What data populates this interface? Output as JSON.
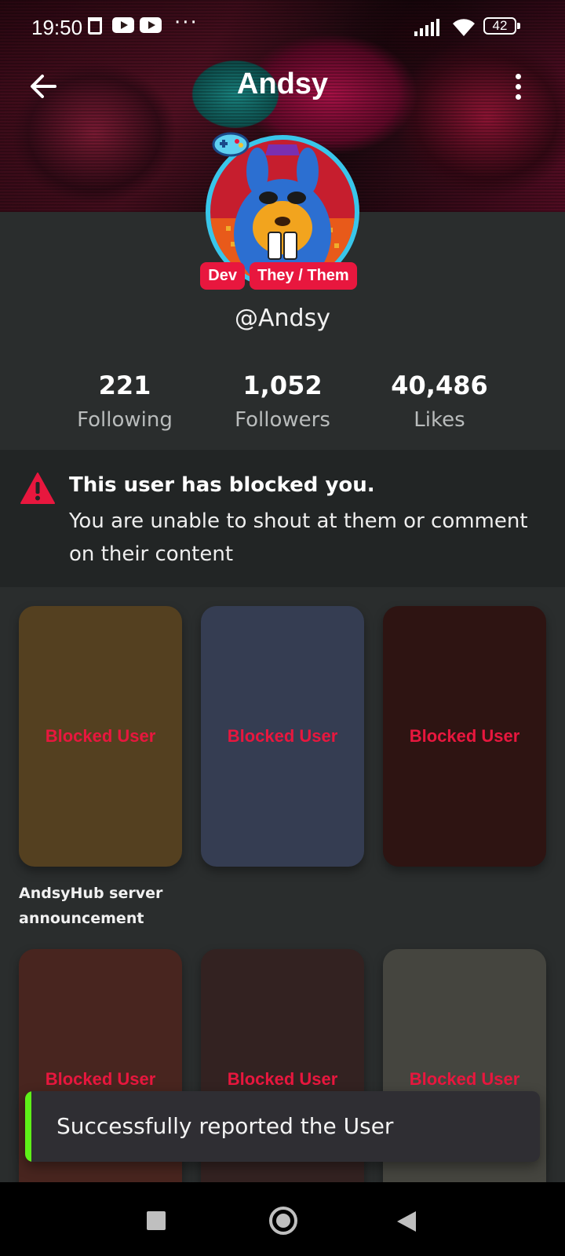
{
  "status_bar": {
    "time": "19:50",
    "battery": "42"
  },
  "header": {
    "title": "Andsy"
  },
  "profile": {
    "badges": [
      "Dev",
      "They / Them"
    ],
    "handle": "@Andsy"
  },
  "stats": [
    {
      "value": "221",
      "label": "Following"
    },
    {
      "value": "1,052",
      "label": "Followers"
    },
    {
      "value": "40,486",
      "label": "Likes"
    }
  ],
  "notice": {
    "title": "This user has blocked you.",
    "body": "You are unable to shout at them or comment on their content"
  },
  "posts": [
    {
      "label": "Blocked User",
      "color": "#544020",
      "caption": "AndsyHub server announcement"
    },
    {
      "label": "Blocked User",
      "color": "#353d52",
      "caption": ""
    },
    {
      "label": "Blocked User",
      "color": "#2e1412",
      "caption": ""
    },
    {
      "label": "Blocked User",
      "color": "#48251f",
      "caption": ""
    },
    {
      "label": "Blocked User",
      "color": "#332221",
      "caption": ""
    },
    {
      "label": "Blocked User",
      "color": "#45453f",
      "caption": ""
    }
  ],
  "toast": {
    "message": "Successfully reported the User",
    "accent": "#5ef018"
  },
  "colors": {
    "accent": "#e8173e",
    "background": "#2a2d2d"
  }
}
